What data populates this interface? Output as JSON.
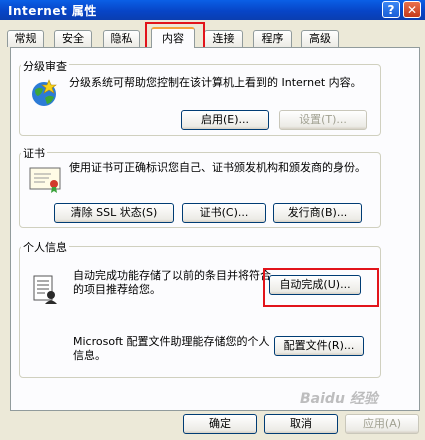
{
  "window": {
    "title": "Internet 属性",
    "help_glyph": "?",
    "close_glyph": "✕"
  },
  "tabs": [
    "常规",
    "安全",
    "隐私",
    "内容",
    "连接",
    "程序",
    "高级"
  ],
  "active_tab": "内容",
  "rating": {
    "label": "分级审查",
    "description": "分级系统可帮助您控制在该计算机上看到的 Internet 内容。",
    "enable_button": "启用(E)...",
    "settings_button": "设置(T)..."
  },
  "certificates": {
    "label": "证书",
    "description": "使用证书可正确标识您自己、证书颁发机构和颁发商的身份。",
    "clear_ssl_button": "清除 SSL 状态(S)",
    "certificates_button": "证书(C)...",
    "publishers_button": "发行商(B)..."
  },
  "personal": {
    "label": "个人信息",
    "autocomplete_text": "自动完成功能存储了以前的条目并将符合的项目推荐给您。",
    "autocomplete_button": "自动完成(U)...",
    "profile_text": "Microsoft 配置文件助理能存储您的个人信息。",
    "profile_button": "配置文件(R)..."
  },
  "footer": {
    "ok": "确定",
    "cancel": "取消",
    "apply": "应用(A)"
  },
  "watermark": "Baidu 经验",
  "colors": {
    "titlebar": "#0745c7",
    "highlight": "#e2141b",
    "tab_accent": "#f5a23c"
  }
}
